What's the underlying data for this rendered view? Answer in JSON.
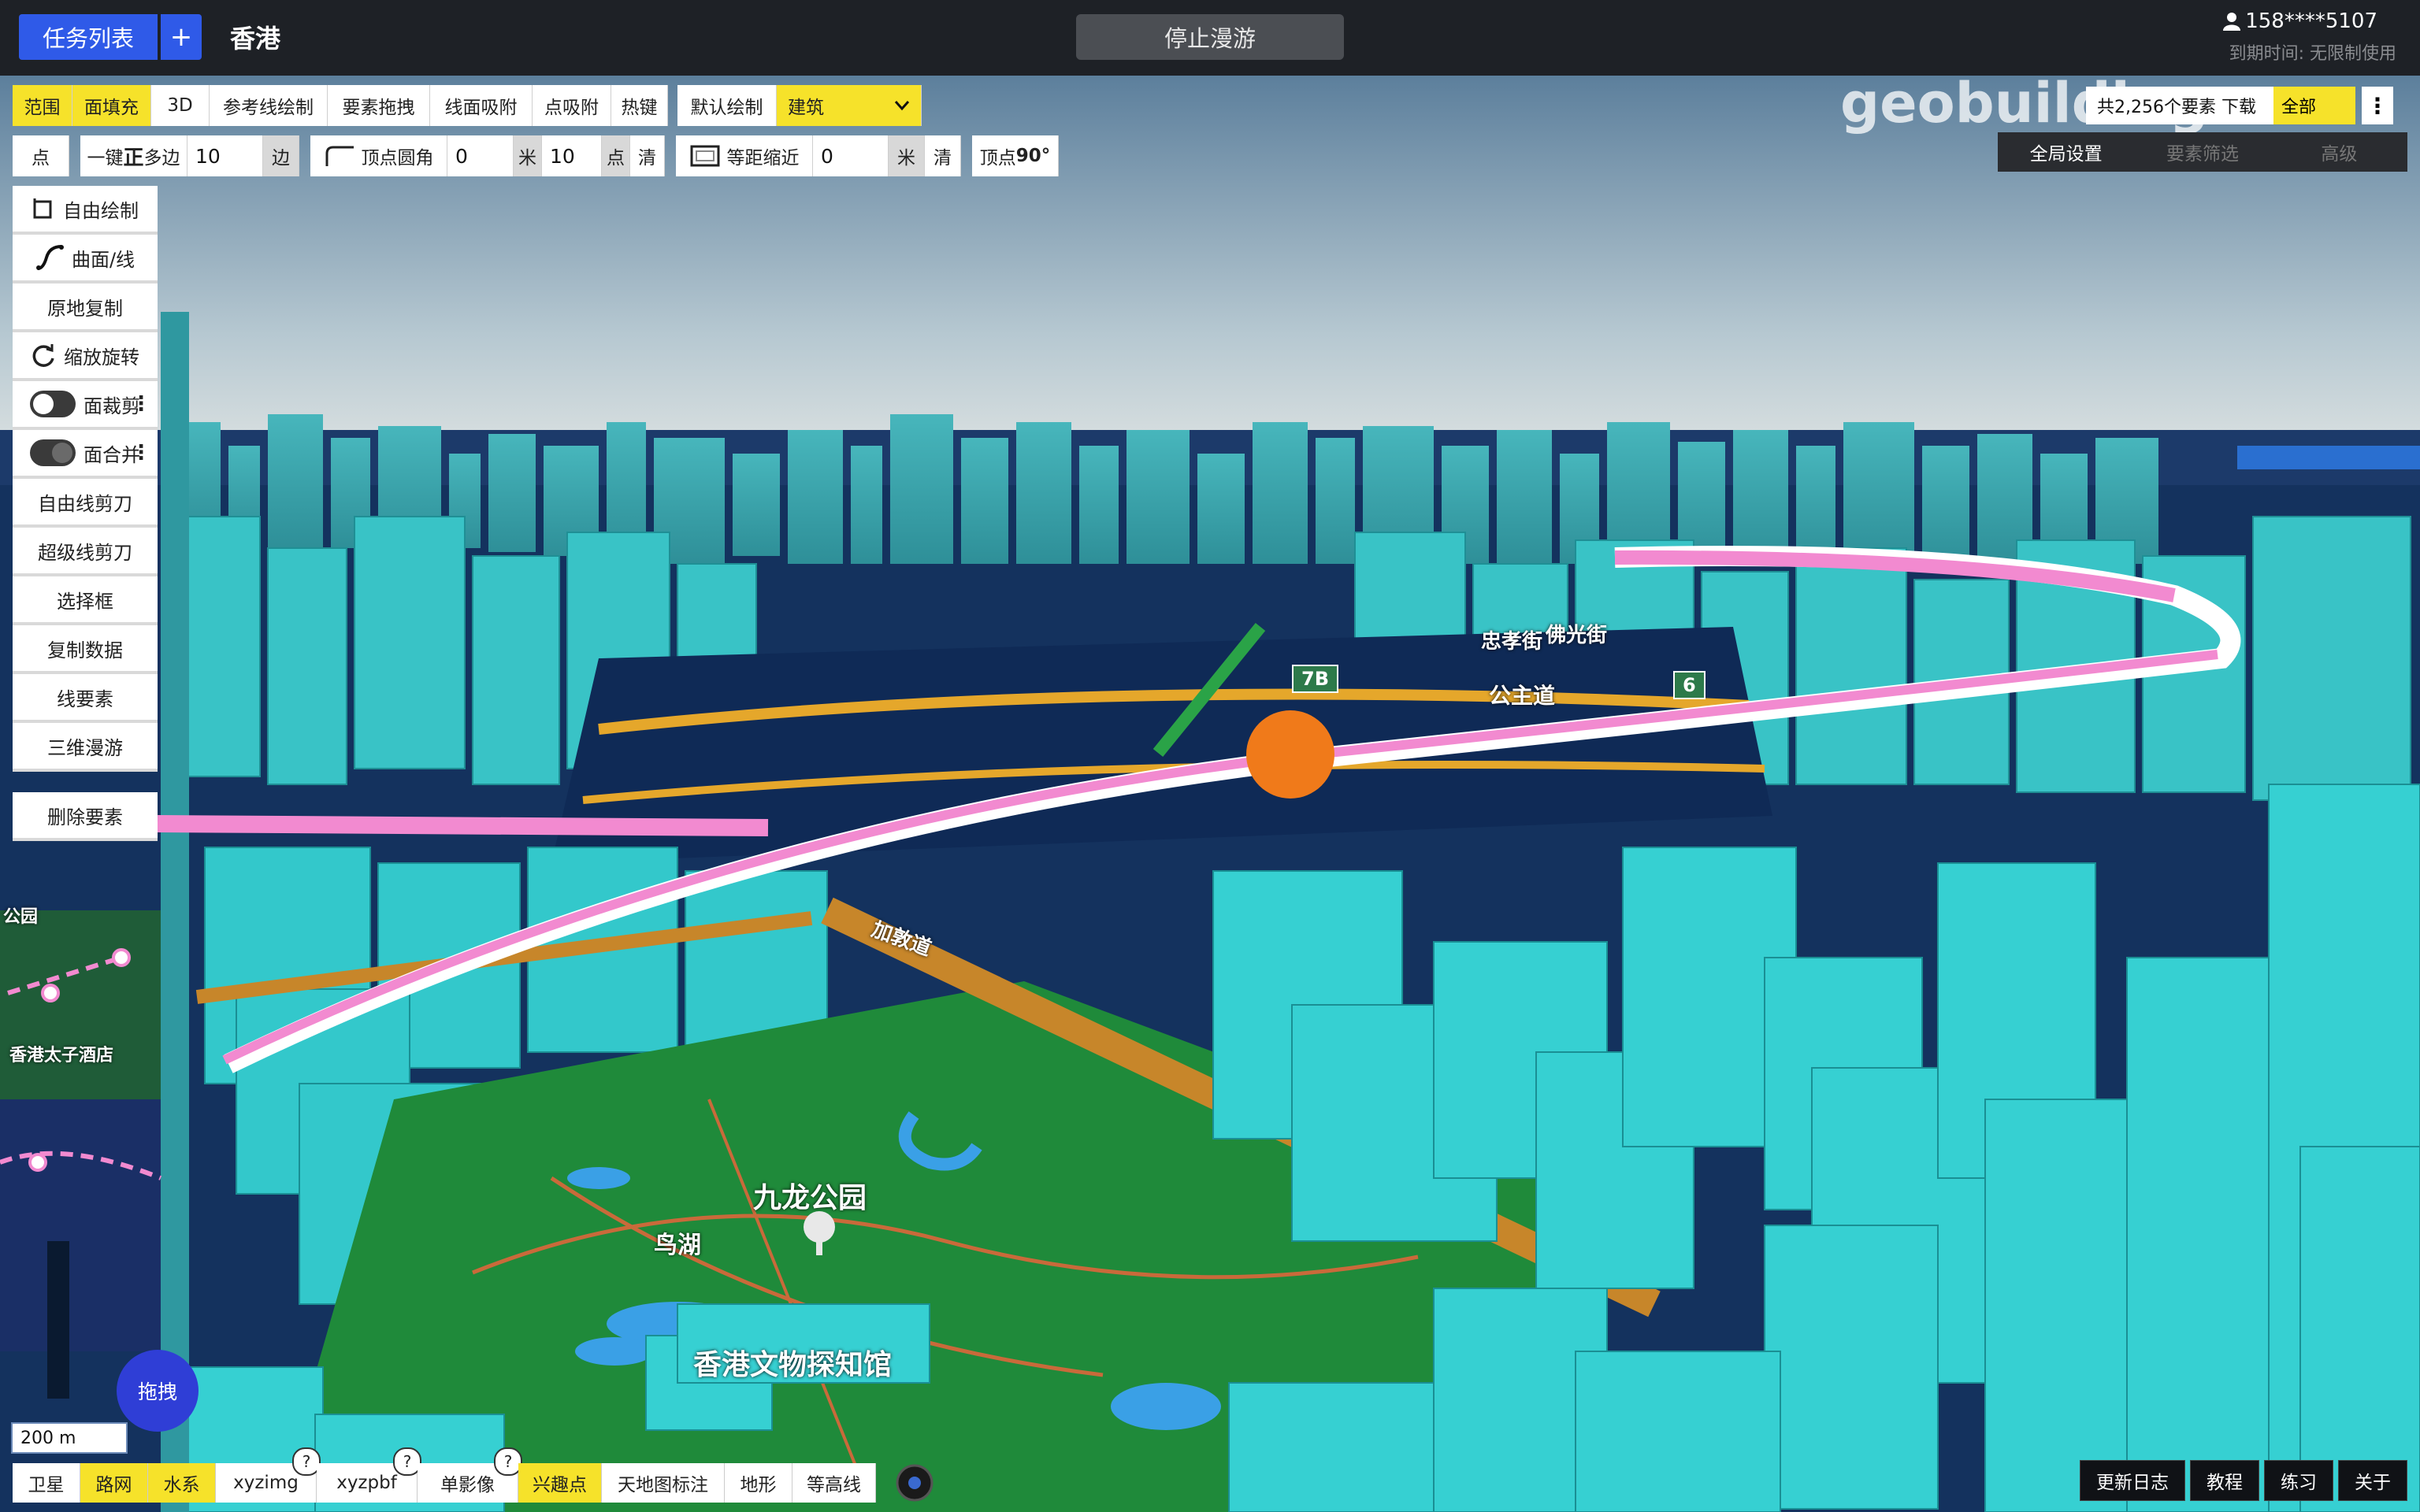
{
  "header": {
    "task_list": "任务列表",
    "add": "+",
    "city": "香港",
    "stop_tour": "停止漫游",
    "user": "158****5107",
    "expire": "到期时间: 无限制使用"
  },
  "toolbar1": {
    "range": "范围",
    "fill": "面填充",
    "three_d": "3D",
    "ref_line": "参考线绘制",
    "drag": "要素拖拽",
    "snap_line": "线面吸附",
    "snap_point": "点吸附",
    "hotkey": "热键",
    "default_draw": "默认绘制",
    "layer_select": "建筑"
  },
  "toolbar2": {
    "point": "点",
    "regular_polygon_prefix": "一键",
    "regular_polygon_bold": "正",
    "regular_polygon_suffix": "多边",
    "sides_value": "10",
    "sides_unit": "边",
    "vertex_round": "顶点圆角",
    "round_value": "0",
    "round_unit": "米",
    "round_points": "10",
    "points_unit": "点",
    "clear1": "清",
    "equal_shrink": "等距缩近",
    "shrink_value": "0",
    "shrink_unit": "米",
    "clear2": "清",
    "vertex90_prefix": "顶点",
    "vertex90_bold": "90°"
  },
  "sidebar": {
    "free_draw": "自由绘制",
    "curve": "曲面/线",
    "copy_in_place": "原地复制",
    "scale_rotate": "缩放旋转",
    "face_clip": "面裁剪",
    "face_merge": "面合并",
    "free_line_cut": "自由线剪刀",
    "super_line_cut": "超级线剪刀",
    "select_box": "选择框",
    "copy_data": "复制数据",
    "line_feature": "线要素",
    "tour_3d": "三维漫游",
    "delete_feature": "删除要素"
  },
  "right_panel": {
    "count_text": "共2,256个要素 下载",
    "all": "全部",
    "global_settings": "全局设置",
    "feature_filter": "要素筛选",
    "advanced": "高级",
    "watermark": "geobuilding"
  },
  "map_labels": {
    "park": "九龙公园",
    "lake": "鸟湖",
    "museum": "香港文物探知馆",
    "hotel": "香港太子酒店",
    "park_left": "公园",
    "zhongxiao": "忠孝街",
    "foguang": "佛光街",
    "gongshi": "公主道",
    "jiaodao": "加敦道",
    "badge_7b": "7B",
    "badge_6": "6"
  },
  "bottom": {
    "drag": "拖拽",
    "scale": "200 m",
    "satellite": "卫星",
    "road": "路网",
    "water": "水系",
    "xyzimg": "xyzimg",
    "xyzpbf": "xyzpbf",
    "single_image": "单影像",
    "poi": "兴趣点",
    "tianditu": "天地图标注",
    "terrain": "地形",
    "contour": "等高线",
    "q": "?"
  },
  "bottom_right": {
    "changelog": "更新日志",
    "tutorial": "教程",
    "practice": "练习",
    "about": "关于"
  },
  "colors": {
    "accent_blue": "#2f5ae8",
    "yellow": "#f6e22a",
    "building": "#2fc8c8",
    "park": "#1f8a3a",
    "path": "#f28ad0"
  }
}
